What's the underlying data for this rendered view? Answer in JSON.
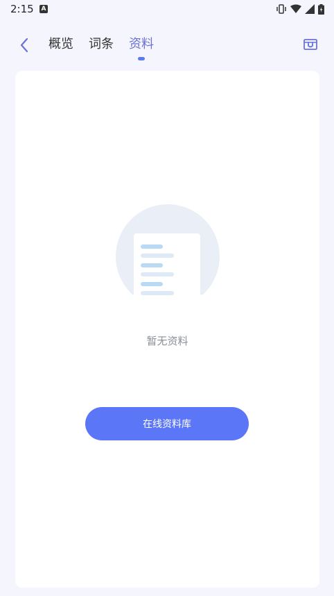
{
  "status_bar": {
    "time": "2:15",
    "app_icon": "A"
  },
  "header": {
    "back_icon": "chevron-left-icon",
    "tabs": [
      {
        "label": "概览",
        "active": false
      },
      {
        "label": "词条",
        "active": false
      },
      {
        "label": "资料",
        "active": true
      }
    ],
    "right_icon": "box-icon"
  },
  "main": {
    "empty_illustration": "document-icon",
    "empty_text": "暂无资料",
    "library_button_label": "在线资料库"
  },
  "colors": {
    "background": "#f5f5fd",
    "card": "#ffffff",
    "active_tab": "#6a71d8",
    "indicator": "#5a7bef",
    "primary_button": "#5b76f6",
    "empty_text": "#8a8f99"
  }
}
